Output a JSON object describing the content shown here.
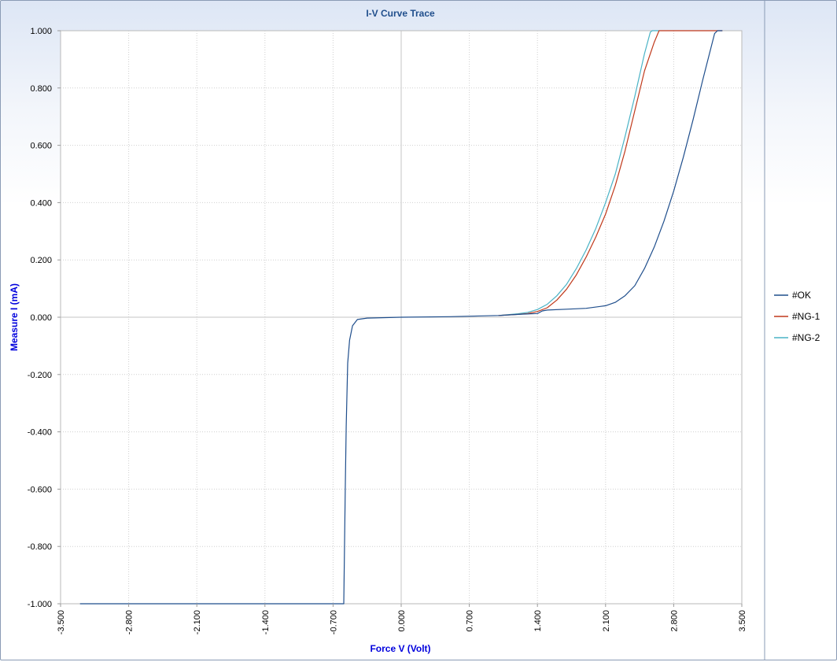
{
  "chart_data": {
    "type": "line",
    "title": "I-V Curve Trace",
    "xlabel": "Force V (Volt)",
    "ylabel": "Measure I (mA)",
    "xlim": [
      -3.5,
      3.5
    ],
    "ylim": [
      -1.0,
      1.0
    ],
    "x_ticks": [
      "-3.500",
      "-2.800",
      "-2.100",
      "-1.400",
      "-0.700",
      "0.000",
      "0.700",
      "1.400",
      "2.100",
      "2.800",
      "3.500"
    ],
    "y_ticks": [
      "1.000",
      "0.800",
      "0.600",
      "0.400",
      "0.200",
      "0.000",
      "-0.200",
      "-0.400",
      "-0.600",
      "-0.800",
      "-1.000"
    ],
    "grid": true,
    "legend_position": "right",
    "series": [
      {
        "name": "#OK",
        "color": "#1f4e8c",
        "points": [
          [
            -3.3,
            -1.0
          ],
          [
            -0.59,
            -1.0
          ],
          [
            -0.575,
            -0.6
          ],
          [
            -0.565,
            -0.38
          ],
          [
            -0.55,
            -0.16
          ],
          [
            -0.53,
            -0.08
          ],
          [
            -0.5,
            -0.03
          ],
          [
            -0.45,
            -0.008
          ],
          [
            -0.35,
            -0.003
          ],
          [
            0.0,
            0.0
          ],
          [
            0.5,
            0.002
          ],
          [
            1.0,
            0.006
          ],
          [
            1.2,
            0.01
          ],
          [
            1.4,
            0.013
          ],
          [
            1.45,
            0.022
          ],
          [
            1.5,
            0.025
          ],
          [
            1.7,
            0.028
          ],
          [
            1.9,
            0.031
          ],
          [
            2.1,
            0.04
          ],
          [
            2.2,
            0.052
          ],
          [
            2.3,
            0.075
          ],
          [
            2.4,
            0.11
          ],
          [
            2.5,
            0.17
          ],
          [
            2.6,
            0.245
          ],
          [
            2.7,
            0.335
          ],
          [
            2.8,
            0.44
          ],
          [
            2.9,
            0.56
          ],
          [
            3.0,
            0.69
          ],
          [
            3.1,
            0.83
          ],
          [
            3.22,
            0.99
          ],
          [
            3.25,
            1.0
          ],
          [
            3.3,
            1.0
          ]
        ]
      },
      {
        "name": "#NG-1",
        "color": "#c0391b",
        "points": [
          [
            1.0,
            0.006
          ],
          [
            1.2,
            0.01
          ],
          [
            1.3,
            0.013
          ],
          [
            1.4,
            0.02
          ],
          [
            1.5,
            0.033
          ],
          [
            1.6,
            0.06
          ],
          [
            1.7,
            0.098
          ],
          [
            1.8,
            0.148
          ],
          [
            1.9,
            0.21
          ],
          [
            2.0,
            0.28
          ],
          [
            2.1,
            0.36
          ],
          [
            2.2,
            0.46
          ],
          [
            2.3,
            0.58
          ],
          [
            2.4,
            0.72
          ],
          [
            2.5,
            0.86
          ],
          [
            2.6,
            0.96
          ],
          [
            2.65,
            1.0
          ],
          [
            3.3,
            1.0
          ]
        ]
      },
      {
        "name": "#NG-2",
        "color": "#4ab3c6",
        "points": [
          [
            1.0,
            0.006
          ],
          [
            1.2,
            0.012
          ],
          [
            1.3,
            0.017
          ],
          [
            1.4,
            0.027
          ],
          [
            1.5,
            0.045
          ],
          [
            1.6,
            0.075
          ],
          [
            1.7,
            0.115
          ],
          [
            1.8,
            0.17
          ],
          [
            1.9,
            0.235
          ],
          [
            2.0,
            0.31
          ],
          [
            2.1,
            0.4
          ],
          [
            2.2,
            0.5
          ],
          [
            2.3,
            0.63
          ],
          [
            2.4,
            0.77
          ],
          [
            2.5,
            0.92
          ],
          [
            2.56,
            0.995
          ],
          [
            2.58,
            1.0
          ],
          [
            2.65,
            1.0
          ]
        ]
      }
    ]
  }
}
